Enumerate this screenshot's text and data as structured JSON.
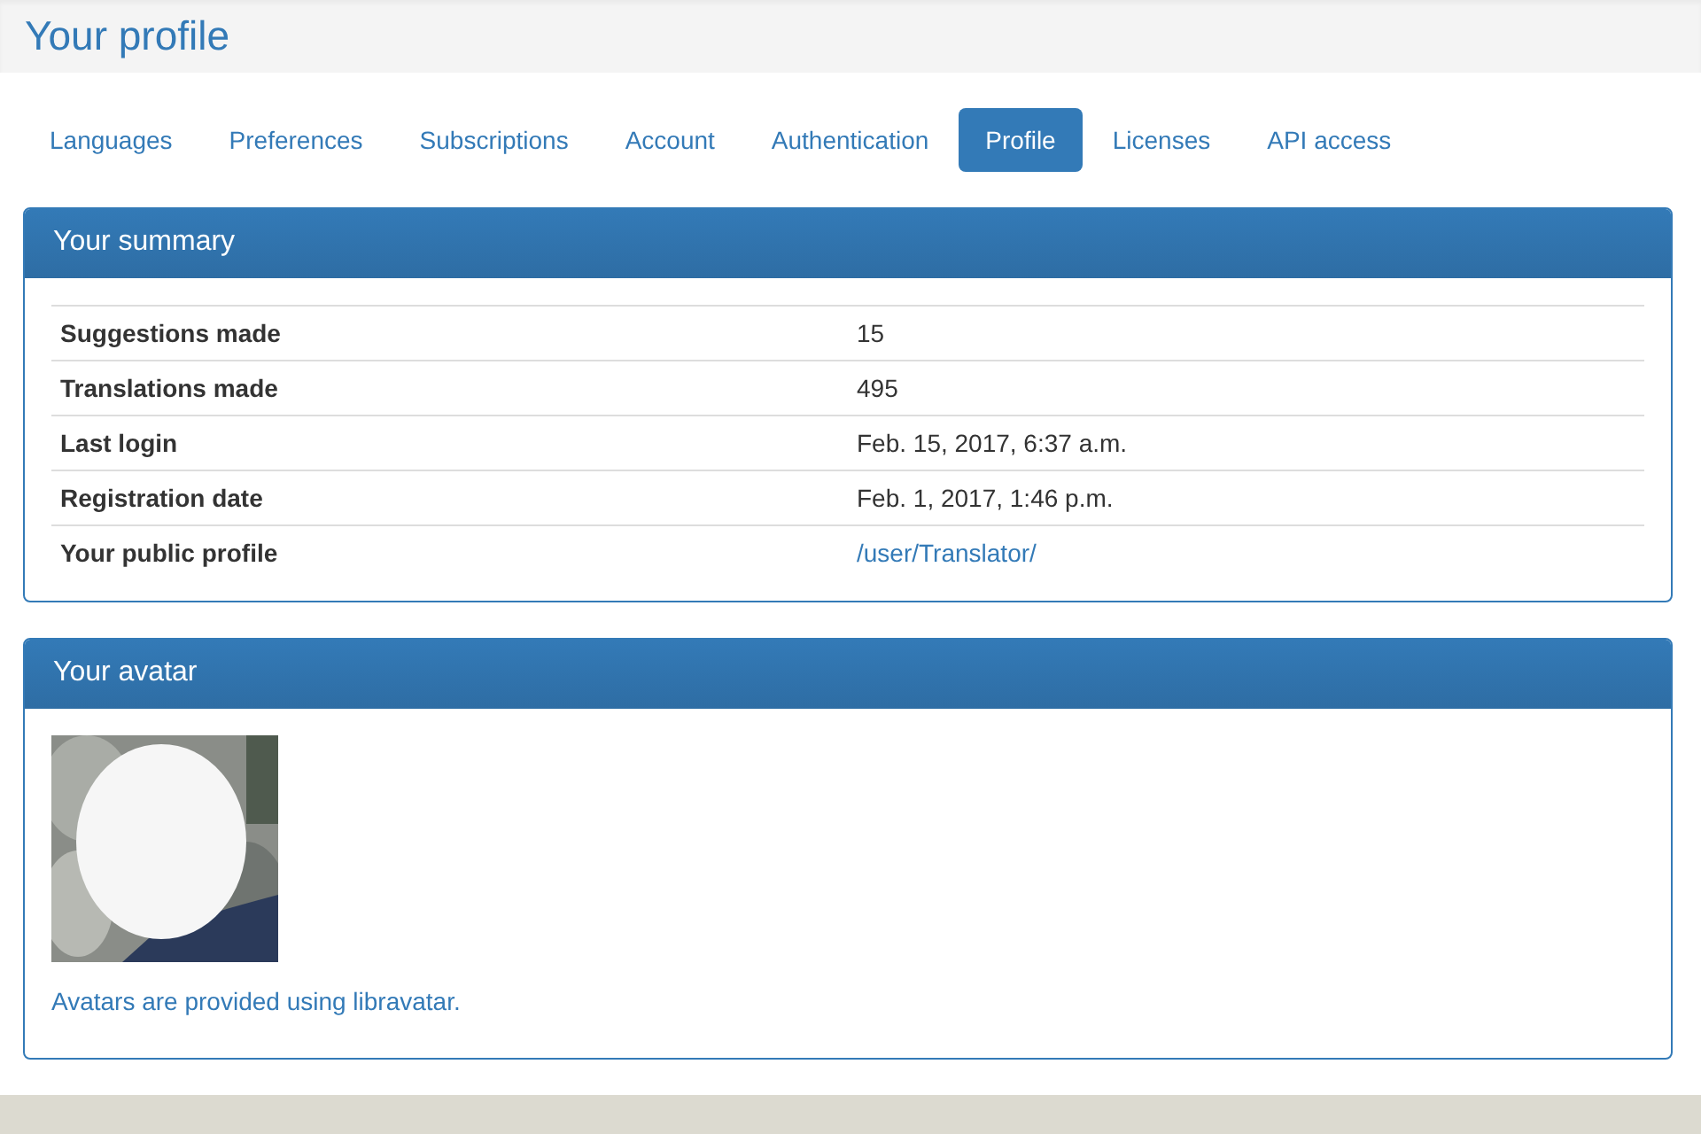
{
  "page_title": "Your profile",
  "tabs": [
    {
      "label": "Languages",
      "selected": false
    },
    {
      "label": "Preferences",
      "selected": false
    },
    {
      "label": "Subscriptions",
      "selected": false
    },
    {
      "label": "Account",
      "selected": false
    },
    {
      "label": "Authentication",
      "selected": false
    },
    {
      "label": "Profile",
      "selected": true
    },
    {
      "label": "Licenses",
      "selected": false
    },
    {
      "label": "API access",
      "selected": false
    }
  ],
  "summary": {
    "title": "Your summary",
    "rows": [
      {
        "label": "Suggestions made",
        "value": "15",
        "kind": "text"
      },
      {
        "label": "Translations made",
        "value": "495",
        "kind": "text"
      },
      {
        "label": "Last login",
        "value": "Feb. 15, 2017, 6:37 a.m.",
        "kind": "text"
      },
      {
        "label": "Registration date",
        "value": "Feb. 1, 2017, 1:46 p.m.",
        "kind": "text"
      },
      {
        "label": "Your public profile",
        "value": "/user/Translator/",
        "kind": "link"
      }
    ]
  },
  "avatar": {
    "title": "Your avatar",
    "note": "Avatars are provided using libravatar."
  }
}
